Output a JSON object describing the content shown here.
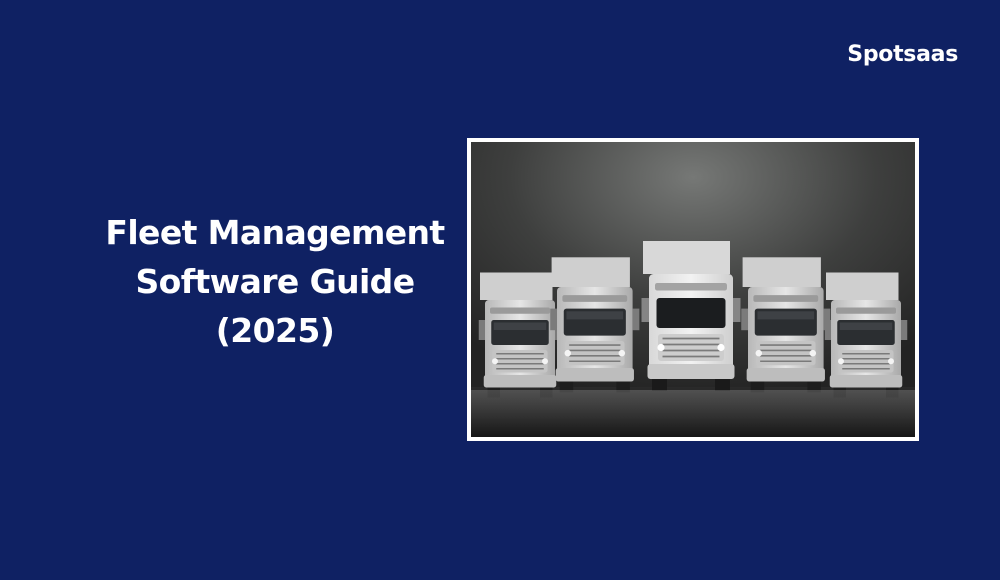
{
  "brand": {
    "logo_text": "Spotsaas"
  },
  "headline": {
    "line1": "Fleet Management",
    "line2": "Software Guide",
    "line3": "(2025)"
  },
  "photo": {
    "subject": "five-white-semi-trucks-icon"
  },
  "colors": {
    "background": "#0f2163",
    "text": "#ffffff",
    "photo_border": "#ffffff"
  }
}
